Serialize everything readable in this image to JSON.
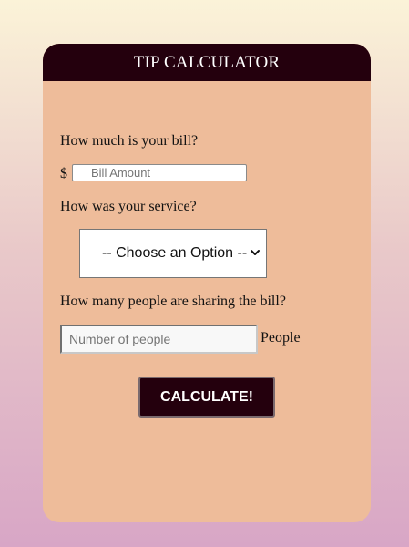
{
  "header": {
    "title": "TIP CALCULATOR"
  },
  "bill": {
    "question": "How much is your bill?",
    "currency_symbol": "$",
    "placeholder": "Bill Amount",
    "value": ""
  },
  "service": {
    "question": "How was your service?",
    "selected_option": "-- Choose an Option --"
  },
  "people": {
    "question": "How many people are sharing the bill?",
    "placeholder": "Number of people",
    "value": "",
    "unit_label": "People"
  },
  "actions": {
    "calculate_label": "CALCULATE!"
  },
  "colors": {
    "header_bg": "#24000d",
    "card_bg": "#eebc9a",
    "button_bg": "#24000d"
  },
  "icons": {
    "select_arrow": "chevron-down-icon"
  }
}
